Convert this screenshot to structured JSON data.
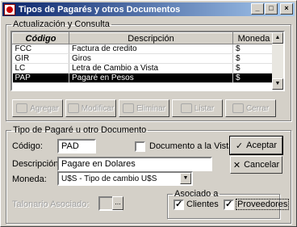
{
  "window": {
    "title": "Tipos de Pagarés y otros Documentos",
    "min_glyph": "_",
    "max_glyph": "□",
    "close_glyph": "×"
  },
  "consulta": {
    "legend": "Actualización y Consulta",
    "columns": [
      "Código",
      "Descripción",
      "Moneda"
    ],
    "rows": [
      {
        "code": "FCC",
        "desc": "Factura de credito",
        "moneda": "$"
      },
      {
        "code": "GIR",
        "desc": "Giros",
        "moneda": "$"
      },
      {
        "code": "LC",
        "desc": "Letra de Cambio a Vista",
        "moneda": "$"
      },
      {
        "code": "PAP",
        "desc": "Pagaré en Pesos",
        "moneda": "$"
      }
    ],
    "scroll_up": "▲",
    "scroll_down": "▼"
  },
  "toolbar": {
    "agregar": "Agregar",
    "modificar": "Modificar",
    "eliminar": "Eliminar",
    "listar": "Listar",
    "cerrar": "Cerrar"
  },
  "detalle": {
    "legend": "Tipo de Pagaré u otro Documento",
    "codigo_label": "Código:",
    "codigo_value": "PAD",
    "documento_vista_label": "Documento a la Vista",
    "descripcion_label": "Descripción:",
    "descripcion_value": "Pagare en Dolares",
    "moneda_label": "Moneda:",
    "moneda_value": "U$S - Tipo de cambio U$S",
    "talonario_label": "Talonario Asociado:",
    "talonario_btn": "...",
    "asociado_legend": "Asociado a",
    "clientes_label": "Clientes",
    "proveedores_label": "Proveedores"
  },
  "actions": {
    "aceptar": "Aceptar",
    "cancelar": "Cancelar",
    "aceptar_icon": "✓",
    "cancelar_icon": "✕"
  }
}
